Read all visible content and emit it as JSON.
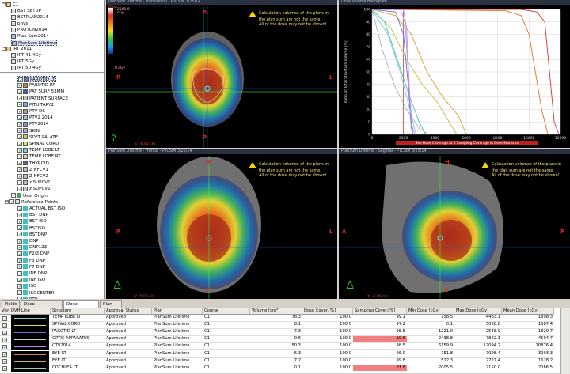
{
  "tree_top": [
    {
      "label": "C1",
      "level": 0,
      "kind": "folder"
    },
    {
      "label": "BST SETUP",
      "level": 1,
      "kind": "plan"
    },
    {
      "label": "BSTPLAN2014",
      "level": 1,
      "kind": "plan"
    },
    {
      "label": "phys",
      "level": 1,
      "kind": "plan"
    },
    {
      "label": "PROTON2014",
      "level": 1,
      "kind": "plan"
    },
    {
      "label": "Plan Sum2014",
      "level": 1,
      "kind": "plansum"
    },
    {
      "label": "PlanSum Lifetime",
      "level": 1,
      "kind": "plansum",
      "selected": true
    },
    {
      "label": "IRT 2011",
      "level": 0,
      "kind": "folder"
    },
    {
      "label": "IRT 41 4Gy",
      "level": 1,
      "kind": "plan"
    },
    {
      "label": "IRT 5Gy",
      "level": 1,
      "kind": "plan"
    },
    {
      "label": "IRT 50 4Gy",
      "level": 1,
      "kind": "plan"
    }
  ],
  "structures": [
    {
      "label": "PAROTID LT",
      "color": "#7070d0",
      "selected": true
    },
    {
      "label": "PAROTID RT",
      "color": "#d08040"
    },
    {
      "label": "PAT SURF 53MM",
      "color": "#4060c0"
    },
    {
      "label": "PATIENT SURFACE",
      "color": "#c0c0c0"
    },
    {
      "label": "PITUITARY2",
      "color": "#80a0ff"
    },
    {
      "label": "PTV DS",
      "color": "#a0a0a0"
    },
    {
      "label": "PTV2 2014",
      "color": "#a0c0ff"
    },
    {
      "label": "PTV2014",
      "color": "#a080ff"
    },
    {
      "label": "SKIN",
      "color": "#c0a0d0"
    },
    {
      "label": "SOFT PALATE",
      "color": "#d0d060"
    },
    {
      "label": "SPINAL CORD",
      "color": "#e0e060"
    },
    {
      "label": "TEMP LOBE LT",
      "color": "#80d0d0"
    },
    {
      "label": "TEMP LOBE RT",
      "color": "#e0d0a0"
    },
    {
      "label": "THYROID",
      "color": "#6060a0"
    },
    {
      "label": "Z NFCV1",
      "color": "#c0c0c0"
    },
    {
      "label": "Z NFCV2",
      "color": "#c0c0c0"
    },
    {
      "label": "z SUPCV1",
      "color": "#c0c0c0"
    },
    {
      "label": "z SUPCV2",
      "color": "#c0c0c0"
    }
  ],
  "user_origin": "User Origin",
  "reference_points": "Reference Points",
  "ref_items": [
    "ACTUAL BST ISO",
    "BST DNP",
    "BST ISO",
    "BSTISO",
    "BSTDNP",
    "DNP",
    "DNP123",
    "F2/3 DNP",
    "F3 DNP",
    "F7 DNP",
    "INF DNP",
    "INF ISO",
    "ISO",
    "ISOCENTER",
    "PTV"
  ],
  "viewports": {
    "transverse_title": "PlanSum Lifetime - Transversal - PTCSIM 3/25/14",
    "frontal_title": "PlanSum Lifetime - Frontal - PTCSIM 3/25/14",
    "sagittal_title": "PlanSum Lifetime - Sagittal - PTCSIM 3/25/14",
    "warning": [
      "Calculation volumes of the plans in",
      "the plan sum are not the same.",
      "All of the dose may not be shown!"
    ],
    "dose_label": "Dose",
    "dose_top": "12269.0",
    "dose_unit": "cGy",
    "dose_bottom": "0 cGy",
    "coord_t": "Z: -6.00 cm",
    "coord_f": "Y: -5.00 cm",
    "coord_s": "X: -3.00 cm",
    "A": "A",
    "P": "P",
    "R": "R",
    "L": "L",
    "H": "H",
    "F": "F"
  },
  "chart_data": {
    "type": "line",
    "title": "Dose Volume Histogram",
    "xlabel": "Dose [cGy]",
    "ylabel": "Ratio of Total Structure Volume [%]",
    "xlim": [
      0,
      12000
    ],
    "ylim": [
      0,
      100
    ],
    "xticks": [
      0,
      2000,
      4000,
      6000,
      8000,
      10000,
      12000
    ],
    "yticks": [
      0,
      10,
      20,
      30,
      40,
      50,
      60,
      70,
      80,
      90,
      100
    ],
    "warning": "See Dose Coverage at 6 Sampling Coverage in Dose Statistics",
    "series": [
      {
        "color": "#e03030",
        "points": [
          [
            0,
            100
          ],
          [
            9500,
            100
          ],
          [
            10500,
            98
          ],
          [
            11000,
            90
          ],
          [
            11300,
            50
          ],
          [
            11600,
            10
          ],
          [
            11900,
            0
          ]
        ]
      },
      {
        "color": "#f07020",
        "points": [
          [
            0,
            100
          ],
          [
            8500,
            99
          ],
          [
            9500,
            95
          ],
          [
            10000,
            80
          ],
          [
            10400,
            50
          ],
          [
            10800,
            20
          ],
          [
            11200,
            0
          ]
        ]
      },
      {
        "color": "#d0a030",
        "points": [
          [
            0,
            100
          ],
          [
            1500,
            95
          ],
          [
            2500,
            80
          ],
          [
            3500,
            50
          ],
          [
            4500,
            30
          ],
          [
            5500,
            15
          ],
          [
            6000,
            0
          ]
        ]
      },
      {
        "color": "#c0c040",
        "points": [
          [
            0,
            100
          ],
          [
            1200,
            85
          ],
          [
            2200,
            60
          ],
          [
            3200,
            40
          ],
          [
            4200,
            25
          ],
          [
            5000,
            8
          ],
          [
            5400,
            0
          ]
        ]
      },
      {
        "color": "#a0a0ff",
        "points": [
          [
            0,
            100
          ],
          [
            1800,
            100
          ],
          [
            2100,
            90
          ],
          [
            2300,
            50
          ],
          [
            2500,
            10
          ],
          [
            2700,
            0
          ]
        ]
      },
      {
        "color": "#7070d0",
        "points": [
          [
            0,
            100
          ],
          [
            1500,
            98
          ],
          [
            2000,
            80
          ],
          [
            2300,
            40
          ],
          [
            2500,
            5
          ],
          [
            2600,
            0
          ]
        ]
      },
      {
        "color": "#40c0c0",
        "points": [
          [
            0,
            100
          ],
          [
            800,
            90
          ],
          [
            1600,
            60
          ],
          [
            2400,
            30
          ],
          [
            3000,
            10
          ],
          [
            3400,
            0
          ]
        ]
      },
      {
        "color": "#80d0d0",
        "points": [
          [
            0,
            100
          ],
          [
            1000,
            80
          ],
          [
            1800,
            50
          ],
          [
            2400,
            20
          ],
          [
            2800,
            0
          ]
        ]
      },
      {
        "color": "#b0b0b0",
        "points": [
          [
            0,
            100
          ],
          [
            600,
            70
          ],
          [
            1400,
            40
          ],
          [
            2200,
            20
          ],
          [
            3000,
            5
          ],
          [
            3600,
            0
          ]
        ]
      },
      {
        "color": "#c080ff",
        "points": [
          [
            0,
            100
          ],
          [
            2000,
            100
          ],
          [
            2200,
            85
          ],
          [
            2400,
            30
          ],
          [
            2600,
            0
          ]
        ]
      }
    ]
  },
  "tabs": [
    "Fields",
    "Dose Prescription",
    "Dose Statistics",
    "Plan Sum"
  ],
  "active_tab": "Dose Statistics",
  "table": {
    "headers": [
      "View",
      "DVH Line",
      "Structure",
      "Approval Status",
      "Plan",
      "Course",
      "Volume [cm³]",
      "Dose Cover.[%]",
      "Sampling Cover.[%]",
      "Min Dose [cGy]",
      "Max Dose [cGy]",
      "Mean Dose [cGy]"
    ],
    "rows": [
      {
        "line": "#80d0d0",
        "structure": "TEMP LOBE LT",
        "status": "Approved",
        "plan": "PlanSum Lifetime",
        "course": "C1",
        "volume": "78.3",
        "dose_cover": "100.0",
        "sampling": "99.1",
        "min": "158.5",
        "max": "4483.1",
        "mean": "1898.3",
        "hl": false
      },
      {
        "line": "#e0e060",
        "structure": "SPINAL CORD",
        "status": "Approved",
        "plan": "PlanSum Lifetime",
        "course": "C1",
        "volume": "8.1",
        "dose_cover": "100.0",
        "sampling": "97.2",
        "min": "0.1",
        "max": "5038.8",
        "mean": "1687.4",
        "hl": false
      },
      {
        "line": "#7070d0",
        "structure": "PAROTID LT",
        "status": "Approved",
        "plan": "PlanSum Lifetime",
        "course": "C1",
        "volume": "7.3",
        "dose_cover": "100.0",
        "sampling": "98.5",
        "min": "1221.0",
        "max": "2548.9",
        "mean": "1829.7",
        "hl": false
      },
      {
        "line": "#d0d0d0",
        "structure": "OPTIC APPARATUS",
        "status": "Approved",
        "plan": "PlanSum Lifetime",
        "course": "C1",
        "volume": "0.6",
        "dose_cover": "100.0",
        "sampling": "19.6",
        "min": "2438.8",
        "max": "7822.1",
        "mean": "4504.7",
        "hl": true
      },
      {
        "line": "#c080ff",
        "structure": "CTV2014",
        "status": "Approved",
        "plan": "PlanSum Lifetime",
        "course": "C1",
        "volume": "50.3",
        "dose_cover": "100.0",
        "sampling": "98.5",
        "min": "6159.9",
        "max": "12094.2",
        "mean": "10876.4",
        "hl": false
      },
      {
        "line": "#d08040",
        "structure": "EYE RT",
        "status": "Approved",
        "plan": "PlanSum Lifetime",
        "course": "C1",
        "volume": "6.3",
        "dose_cover": "100.0",
        "sampling": "96.0",
        "min": "751.8",
        "max": "7098.4",
        "mean": "3093.3",
        "hl": false
      },
      {
        "line": "#c0c040",
        "structure": "EYE LT",
        "status": "Approved",
        "plan": "PlanSum Lifetime",
        "course": "C1",
        "volume": "7.2",
        "dose_cover": "100.0",
        "sampling": "99.8",
        "min": "522.3",
        "max": "2727.4",
        "mean": "1628.2",
        "hl": false
      },
      {
        "line": "#80d0d0",
        "structure": "COCHLEA LT",
        "status": "Approved",
        "plan": "PlanSum Lifetime",
        "course": "C1",
        "volume": "0.1",
        "dose_cover": "100.0",
        "sampling": "31.8",
        "min": "2005.5",
        "max": "2150.0",
        "mean": "2086.5",
        "hl": true
      }
    ]
  }
}
